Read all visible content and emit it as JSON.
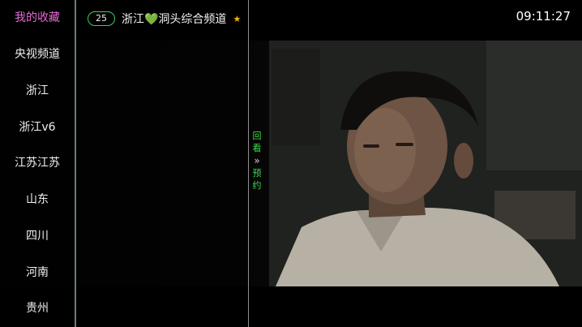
{
  "sidebar": {
    "items": [
      {
        "label": "我的收藏",
        "active": true
      },
      {
        "label": "央视频道"
      },
      {
        "label": "浙江"
      },
      {
        "label": "浙江v6"
      },
      {
        "label": "江苏江苏"
      },
      {
        "label": "山东"
      },
      {
        "label": "四川"
      },
      {
        "label": "河南"
      },
      {
        "label": "贵州"
      }
    ]
  },
  "channel": {
    "number": "25",
    "name": "浙江💚洞头综合频道",
    "favorite_icon": "star-icon"
  },
  "replay_panel": {
    "line1": "回",
    "line2": "看",
    "line3": "预",
    "line4": "约",
    "arrow_icon": "double-chevron-right-icon"
  },
  "clock": "09:11:27",
  "colors": {
    "active": "#e46ad2",
    "accent_green": "#39d05b",
    "star": "#f5b400"
  }
}
